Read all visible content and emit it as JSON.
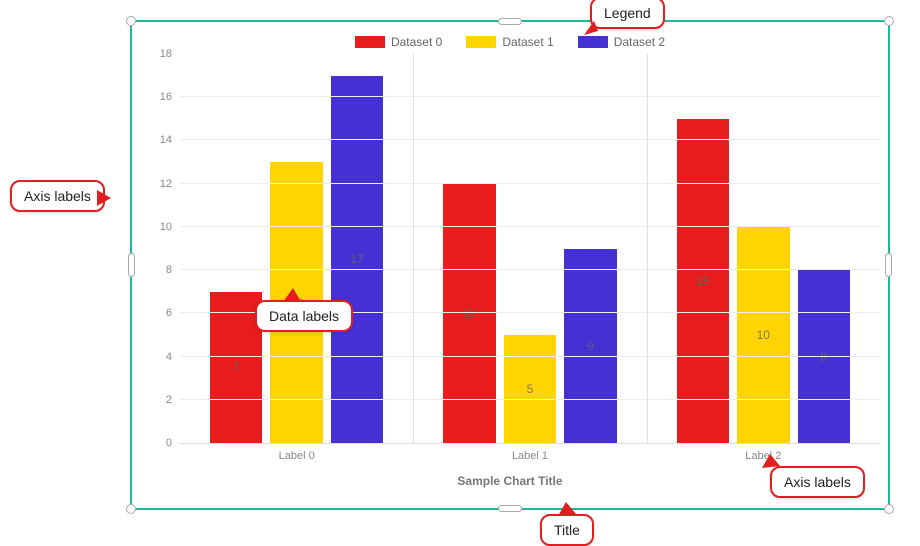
{
  "chart_data": {
    "type": "bar",
    "title": "Sample Chart Title",
    "categories": [
      "Label 0",
      "Label 1",
      "Label 2"
    ],
    "series": [
      {
        "name": "Dataset 0",
        "color": "#e81c1c",
        "values": [
          7,
          12,
          15
        ]
      },
      {
        "name": "Dataset 1",
        "color": "#ffd400",
        "values": [
          13,
          5,
          10
        ]
      },
      {
        "name": "Dataset 2",
        "color": "#4630d4",
        "values": [
          17,
          9,
          8
        ]
      }
    ],
    "data_labels": [
      [
        7,
        12,
        15
      ],
      [
        13,
        5,
        10
      ],
      [
        17,
        9,
        8
      ]
    ],
    "ylim": [
      0,
      18
    ],
    "yticks": [
      0,
      2,
      4,
      6,
      8,
      10,
      12,
      14,
      16,
      18
    ]
  },
  "annotations": {
    "legend": "Legend",
    "axis_labels": "Axis labels",
    "data_labels": "Data labels",
    "title": "Title"
  }
}
